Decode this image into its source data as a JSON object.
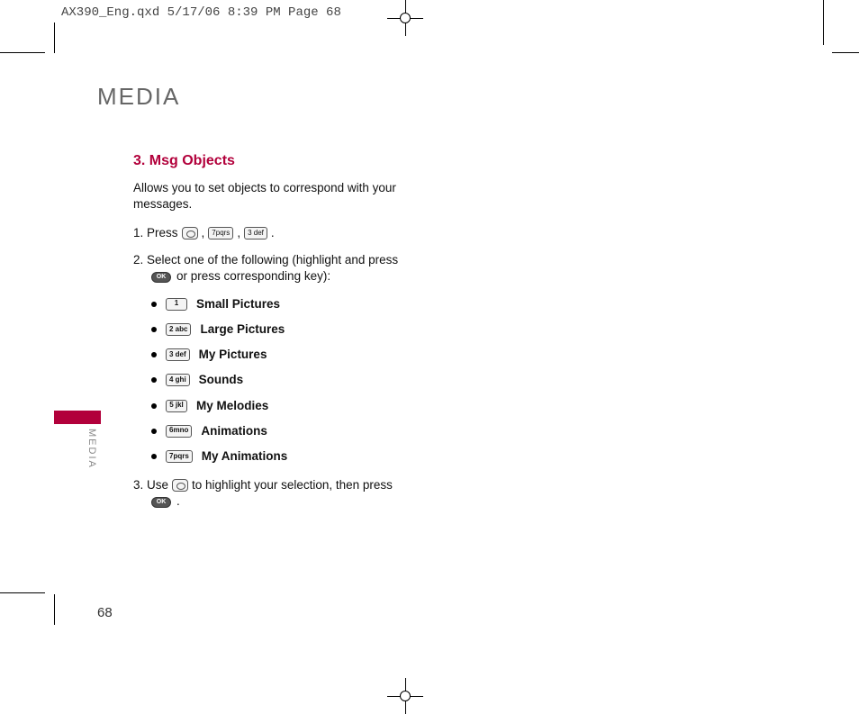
{
  "print_header": "AX390_Eng.qxd  5/17/06  8:39 PM  Page 68",
  "chapter_title": "MEDIA",
  "section": {
    "title": "3. Msg Objects",
    "intro": "Allows you to set objects to correspond with your messages.",
    "step1_prefix": "1. Press",
    "step1_keys": {
      "a": "7pqrs",
      "b": "3 def"
    },
    "step2_line": "2. Select one of the following (highlight and press",
    "step2_tail": "or press corresponding key):",
    "options": [
      {
        "key": "1",
        "label": "Small Pictures"
      },
      {
        "key": "2 abc",
        "label": "Large Pictures"
      },
      {
        "key": "3 def",
        "label": "My Pictures"
      },
      {
        "key": "4 ghi",
        "label": "Sounds"
      },
      {
        "key": "5 jkl",
        "label": "My Melodies"
      },
      {
        "key": "6mno",
        "label": "Animations"
      },
      {
        "key": "7pqrs",
        "label": "My Animations"
      }
    ],
    "step3_prefix": "3. Use",
    "step3_suffix": "to highlight your selection, then press",
    "ok_label": "OK"
  },
  "side_label": "MEDIA",
  "page_number": "68"
}
